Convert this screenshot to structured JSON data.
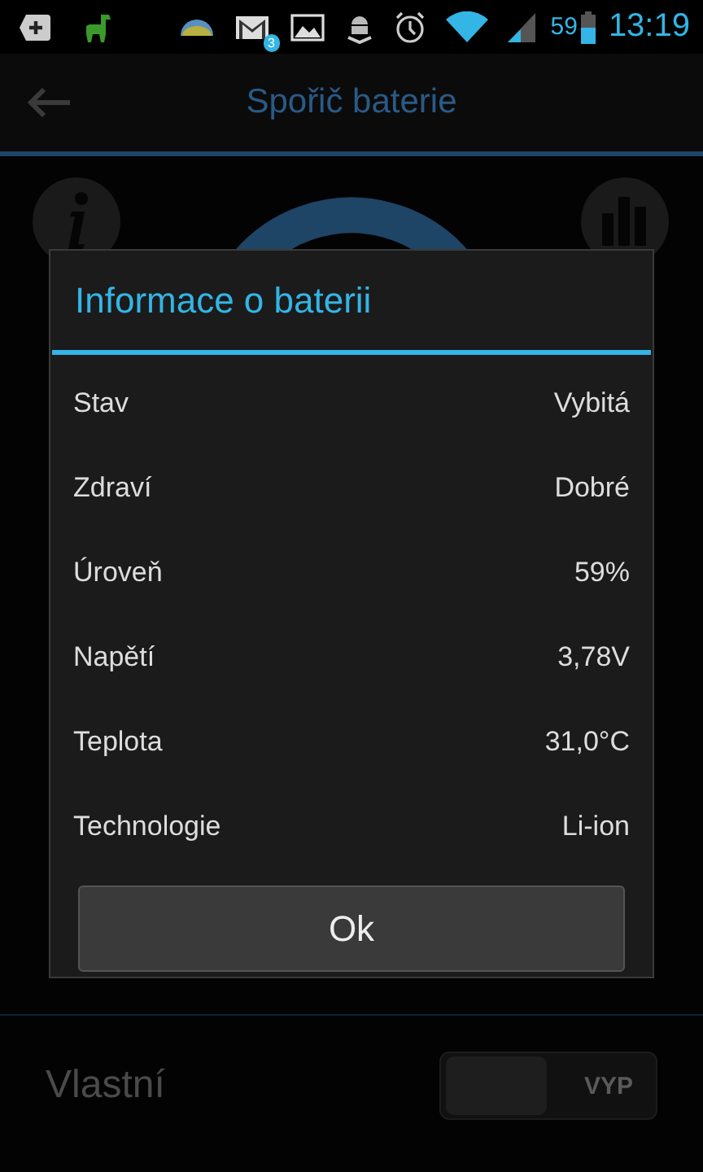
{
  "status_bar": {
    "gmail_badge": "3",
    "battery": "59",
    "time": "13:19"
  },
  "app_bar": {
    "title": "Spořič baterie"
  },
  "dialog": {
    "title": "Informace o baterii",
    "rows": [
      {
        "label": "Stav",
        "value": "Vybitá"
      },
      {
        "label": "Zdraví",
        "value": "Dobré"
      },
      {
        "label": "Úroveň",
        "value": "59%"
      },
      {
        "label": "Napětí",
        "value": "3,78V"
      },
      {
        "label": "Teplota",
        "value": "31,0°C"
      },
      {
        "label": "Technologie",
        "value": "Li-ion"
      }
    ],
    "button": "Ok"
  },
  "setting": {
    "label": "Vlastní",
    "toggle_label": "VYP",
    "on": false
  }
}
